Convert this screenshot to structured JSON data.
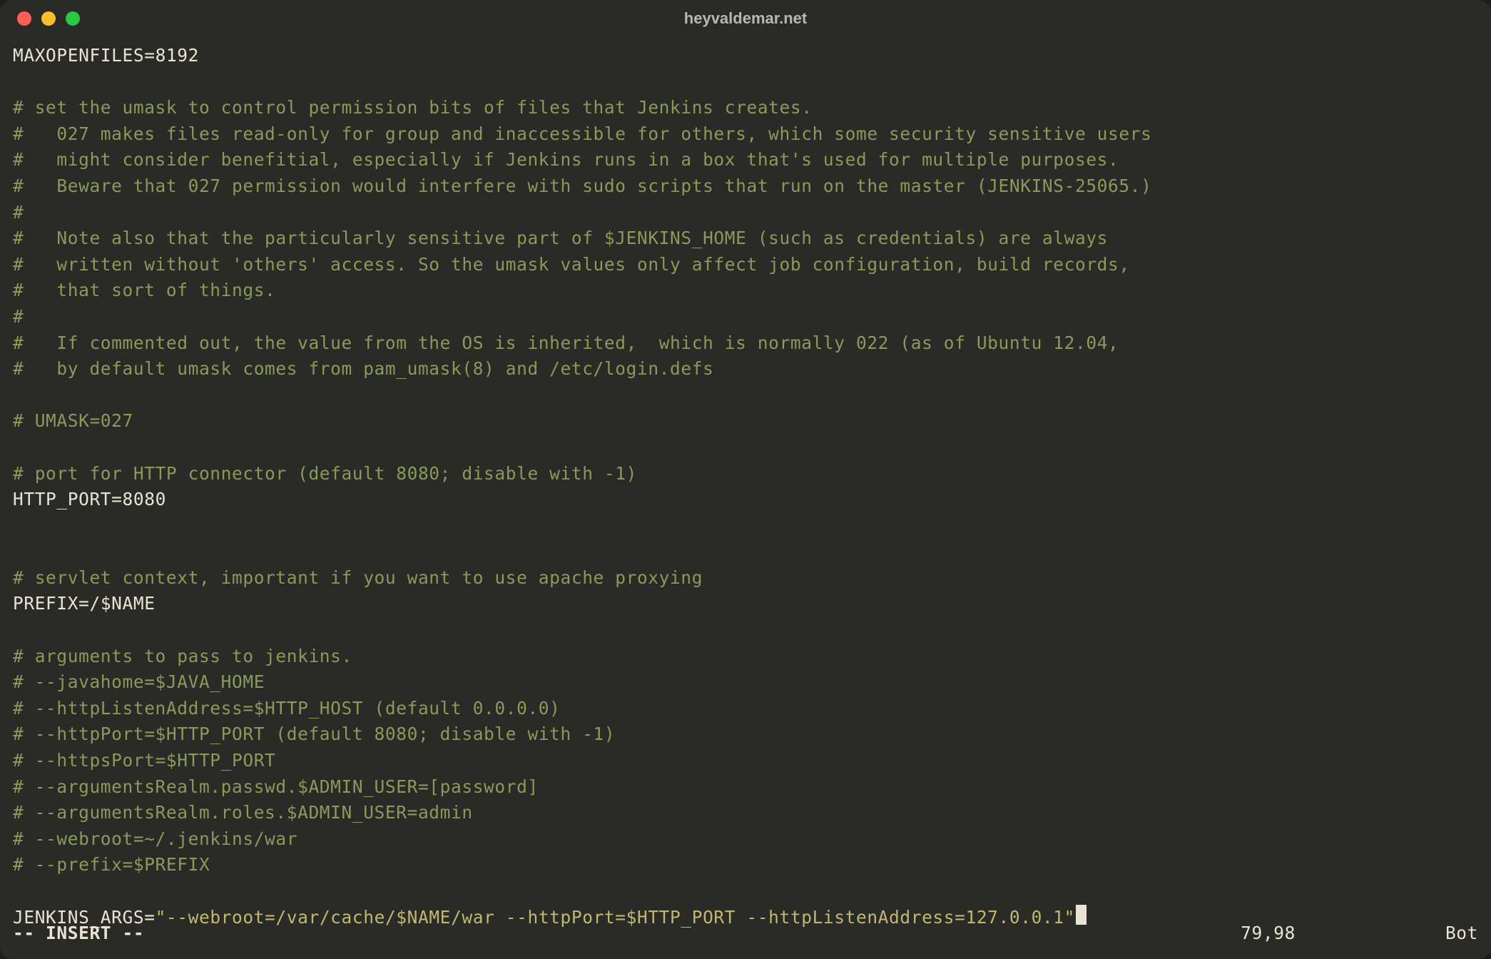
{
  "window": {
    "title": "heyvaldemar.net"
  },
  "lines": [
    {
      "type": "assign",
      "key": "MAXOPENFILES",
      "val": "8192"
    },
    {
      "type": "blank"
    },
    {
      "type": "comment",
      "text": "# set the umask to control permission bits of files that Jenkins creates."
    },
    {
      "type": "comment",
      "text": "#   027 makes files read-only for group and inaccessible for others, which some security sensitive users"
    },
    {
      "type": "comment",
      "text": "#   might consider benefitial, especially if Jenkins runs in a box that's used for multiple purposes."
    },
    {
      "type": "comment",
      "text": "#   Beware that 027 permission would interfere with sudo scripts that run on the master (JENKINS-25065.)"
    },
    {
      "type": "comment",
      "text": "#"
    },
    {
      "type": "comment",
      "text": "#   Note also that the particularly sensitive part of $JENKINS_HOME (such as credentials) are always"
    },
    {
      "type": "comment",
      "text": "#   written without 'others' access. So the umask values only affect job configuration, build records,"
    },
    {
      "type": "comment",
      "text": "#   that sort of things."
    },
    {
      "type": "comment",
      "text": "#"
    },
    {
      "type": "comment",
      "text": "#   If commented out, the value from the OS is inherited,  which is normally 022 (as of Ubuntu 12.04,"
    },
    {
      "type": "comment",
      "text": "#   by default umask comes from pam_umask(8) and /etc/login.defs"
    },
    {
      "type": "blank"
    },
    {
      "type": "comment",
      "text": "# UMASK=027"
    },
    {
      "type": "blank"
    },
    {
      "type": "comment",
      "text": "# port for HTTP connector (default 8080; disable with -1)"
    },
    {
      "type": "assign",
      "key": "HTTP_PORT",
      "val": "8080"
    },
    {
      "type": "blank"
    },
    {
      "type": "blank"
    },
    {
      "type": "comment",
      "text": "# servlet context, important if you want to use apache proxying"
    },
    {
      "type": "assign",
      "key": "PREFIX",
      "val": "/$NAME"
    },
    {
      "type": "blank"
    },
    {
      "type": "comment",
      "text": "# arguments to pass to jenkins."
    },
    {
      "type": "comment",
      "text": "# --javahome=$JAVA_HOME"
    },
    {
      "type": "comment",
      "text": "# --httpListenAddress=$HTTP_HOST (default 0.0.0.0)"
    },
    {
      "type": "comment",
      "text": "# --httpPort=$HTTP_PORT (default 8080; disable with -1)"
    },
    {
      "type": "comment",
      "text": "# --httpsPort=$HTTP_PORT"
    },
    {
      "type": "comment",
      "text": "# --argumentsRealm.passwd.$ADMIN_USER=[password]"
    },
    {
      "type": "comment",
      "text": "# --argumentsRealm.roles.$ADMIN_USER=admin"
    },
    {
      "type": "comment",
      "text": "# --webroot=~/.jenkins/war"
    },
    {
      "type": "comment",
      "text": "# --prefix=$PREFIX"
    },
    {
      "type": "blank"
    },
    {
      "type": "assign-string",
      "key": "JENKINS_ARGS",
      "val": "\"--webroot=/var/cache/$NAME/war --httpPort=$HTTP_PORT --httpListenAddress=127.0.0.1\"",
      "cursor": true
    }
  ],
  "status": {
    "mode": "-- INSERT --",
    "position": "79,98",
    "scroll": "Bot"
  }
}
